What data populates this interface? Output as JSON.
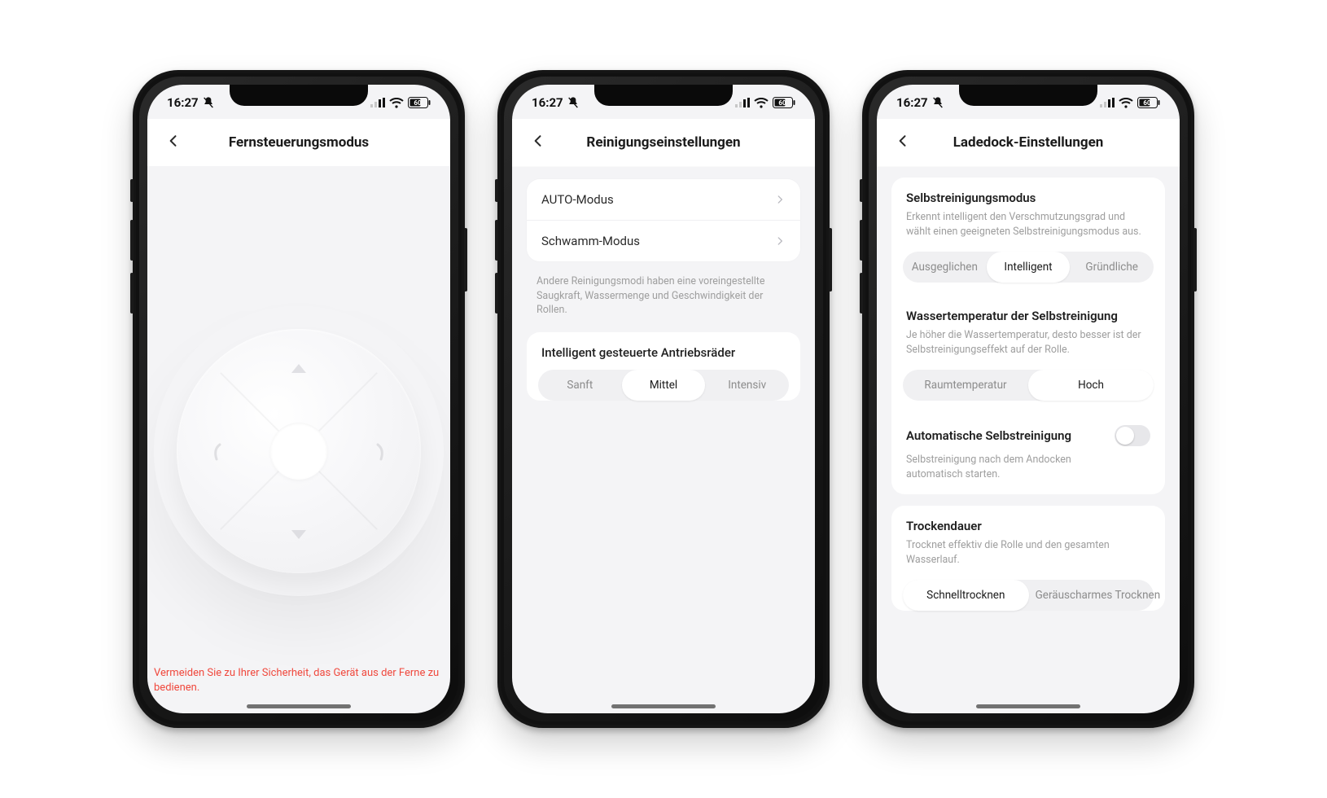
{
  "status": {
    "time": "16:27",
    "battery": "60"
  },
  "screen1": {
    "title": "Fernsteuerungsmodus",
    "warning": "Vermeiden Sie zu Ihrer Sicherheit, das Gerät aus der Ferne zu bedienen."
  },
  "screen2": {
    "title": "Reinigungseinstellungen",
    "rows": {
      "auto": "AUTO-Modus",
      "sponge": "Schwamm-Modus"
    },
    "note": "Andere Reinigungsmodi haben eine voreingestellte Saugkraft, Wassermenge und Geschwindigkeit der Rollen.",
    "wheels": {
      "title": "Intelligent gesteuerte Antriebsräder",
      "options": {
        "soft": "Sanft",
        "mid": "Mittel",
        "intense": "Intensiv"
      },
      "selected": "mid"
    }
  },
  "screen3": {
    "title": "Ladedock-Einstellungen",
    "selfclean": {
      "title": "Selbstreinigungsmodus",
      "desc": "Erkennt intelligent den Verschmutzungsgrad und wählt einen geeigneten Selbstreinigungsmodus aus.",
      "options": {
        "balanced": "Ausgeglichen",
        "smart": "Intelligent",
        "deep": "Gründliche"
      },
      "selected": "smart"
    },
    "watertemp": {
      "title": "Wassertemperatur der Selbstreinigung",
      "desc": "Je höher die Wassertemperatur, desto besser ist der Selbstreinigungseffekt auf der Rolle.",
      "options": {
        "room": "Raumtemperatur",
        "high": "Hoch"
      },
      "selected": "high"
    },
    "autoSelf": {
      "title": "Automatische Selbstreinigung",
      "desc": "Selbstreinigung nach dem Andocken automatisch starten.",
      "on": false
    },
    "drying": {
      "title": "Trockendauer",
      "desc": "Trocknet effektiv die Rolle und den gesamten Wasserlauf.",
      "options": {
        "fast": "Schnelltrocknen",
        "quiet": "Geräuscharmes Trocknen"
      },
      "selected": "fast"
    }
  }
}
